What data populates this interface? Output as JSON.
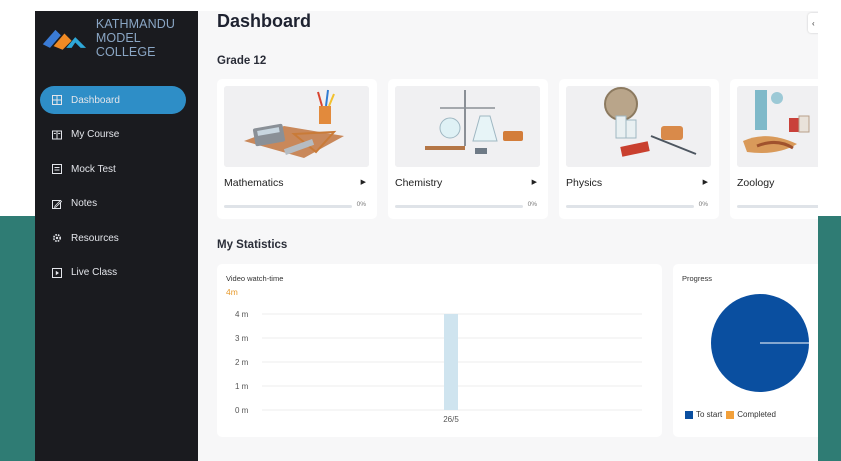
{
  "brand": {
    "line1": "KATHMANDU",
    "line2": "MODEL COLLEGE"
  },
  "sidebar": {
    "items": [
      {
        "label": "Dashboard",
        "icon": "dashboard-icon",
        "active": true
      },
      {
        "label": "My Course",
        "icon": "book-icon",
        "active": false
      },
      {
        "label": "Mock Test",
        "icon": "test-icon",
        "active": false
      },
      {
        "label": "Notes",
        "icon": "pencil-icon",
        "active": false
      },
      {
        "label": "Resources",
        "icon": "gear-icon",
        "active": false
      },
      {
        "label": "Live Class",
        "icon": "play-icon",
        "active": false
      }
    ]
  },
  "main": {
    "title": "Dashboard",
    "grade_title": "Grade 12",
    "stats_title": "My Statistics",
    "courses": [
      {
        "name": "Mathematics",
        "progress": 0,
        "progress_label": "0%"
      },
      {
        "name": "Chemistry",
        "progress": 0,
        "progress_label": "0%"
      },
      {
        "name": "Physics",
        "progress": 0,
        "progress_label": "0%"
      },
      {
        "name": "Zoology",
        "progress": 0,
        "progress_label": ""
      }
    ],
    "watch_time": {
      "label": "Video watch-time",
      "value": "4m"
    },
    "progress_card": {
      "label": "Progress"
    }
  },
  "chart_data": [
    {
      "type": "bar",
      "categories": [
        "26/5"
      ],
      "values": [
        4
      ],
      "y_ticks": [
        "0 m",
        "1 m",
        "2 m",
        "3 m",
        "4 m"
      ],
      "ylim": [
        0,
        4
      ],
      "grid": true,
      "color": "#cfe4ef"
    },
    {
      "type": "pie",
      "labels": [
        "To start",
        "Completed"
      ],
      "values": [
        100,
        0
      ],
      "colors": [
        "#0a4fa0",
        "#f2a03a"
      ],
      "legend_placement": "bottom"
    }
  ],
  "colors": {
    "accent": "#2e8ec7",
    "sidebar_bg": "#1a1b1f",
    "highlight": "#e79a2c"
  }
}
